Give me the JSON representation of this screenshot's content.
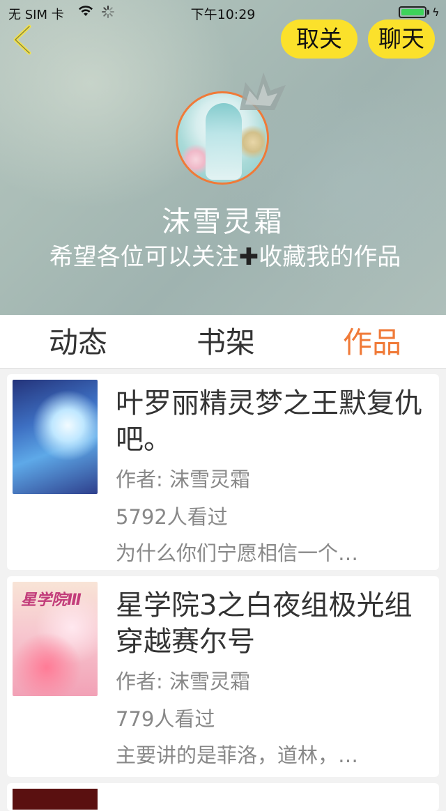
{
  "status_bar": {
    "carrier": "无 SIM 卡",
    "time": "下午10:29",
    "icons": [
      "wifi-icon",
      "spinner-icon",
      "battery-icon",
      "charging-icon"
    ]
  },
  "header": {
    "back_icon": "chevron-left-icon",
    "unfollow_label": "取关",
    "chat_label": "聊天",
    "button_color": "#fbe12b",
    "username": "沫雪灵霜",
    "bio_before": "希望各位可以关注",
    "bio_plus": "✚",
    "bio_after": "收藏我的作品"
  },
  "tabs": {
    "items": [
      {
        "label": "动态"
      },
      {
        "label": "书架"
      },
      {
        "label": "作品"
      }
    ],
    "active_color": "#f07a38"
  },
  "works": [
    {
      "title": "叶罗丽精灵梦之王默复仇吧。",
      "author": "作者: 沫雪灵霜",
      "views": "5792人看过",
      "description": "为什么你们宁愿相信一个…"
    },
    {
      "title": "星学院3之白夜组极光组穿越赛尔号",
      "author": "作者: 沫雪灵霜",
      "views": "779人看过",
      "description": "主要讲的是菲洛，道林，…",
      "cover_text": "星学院Ⅲ"
    }
  ]
}
